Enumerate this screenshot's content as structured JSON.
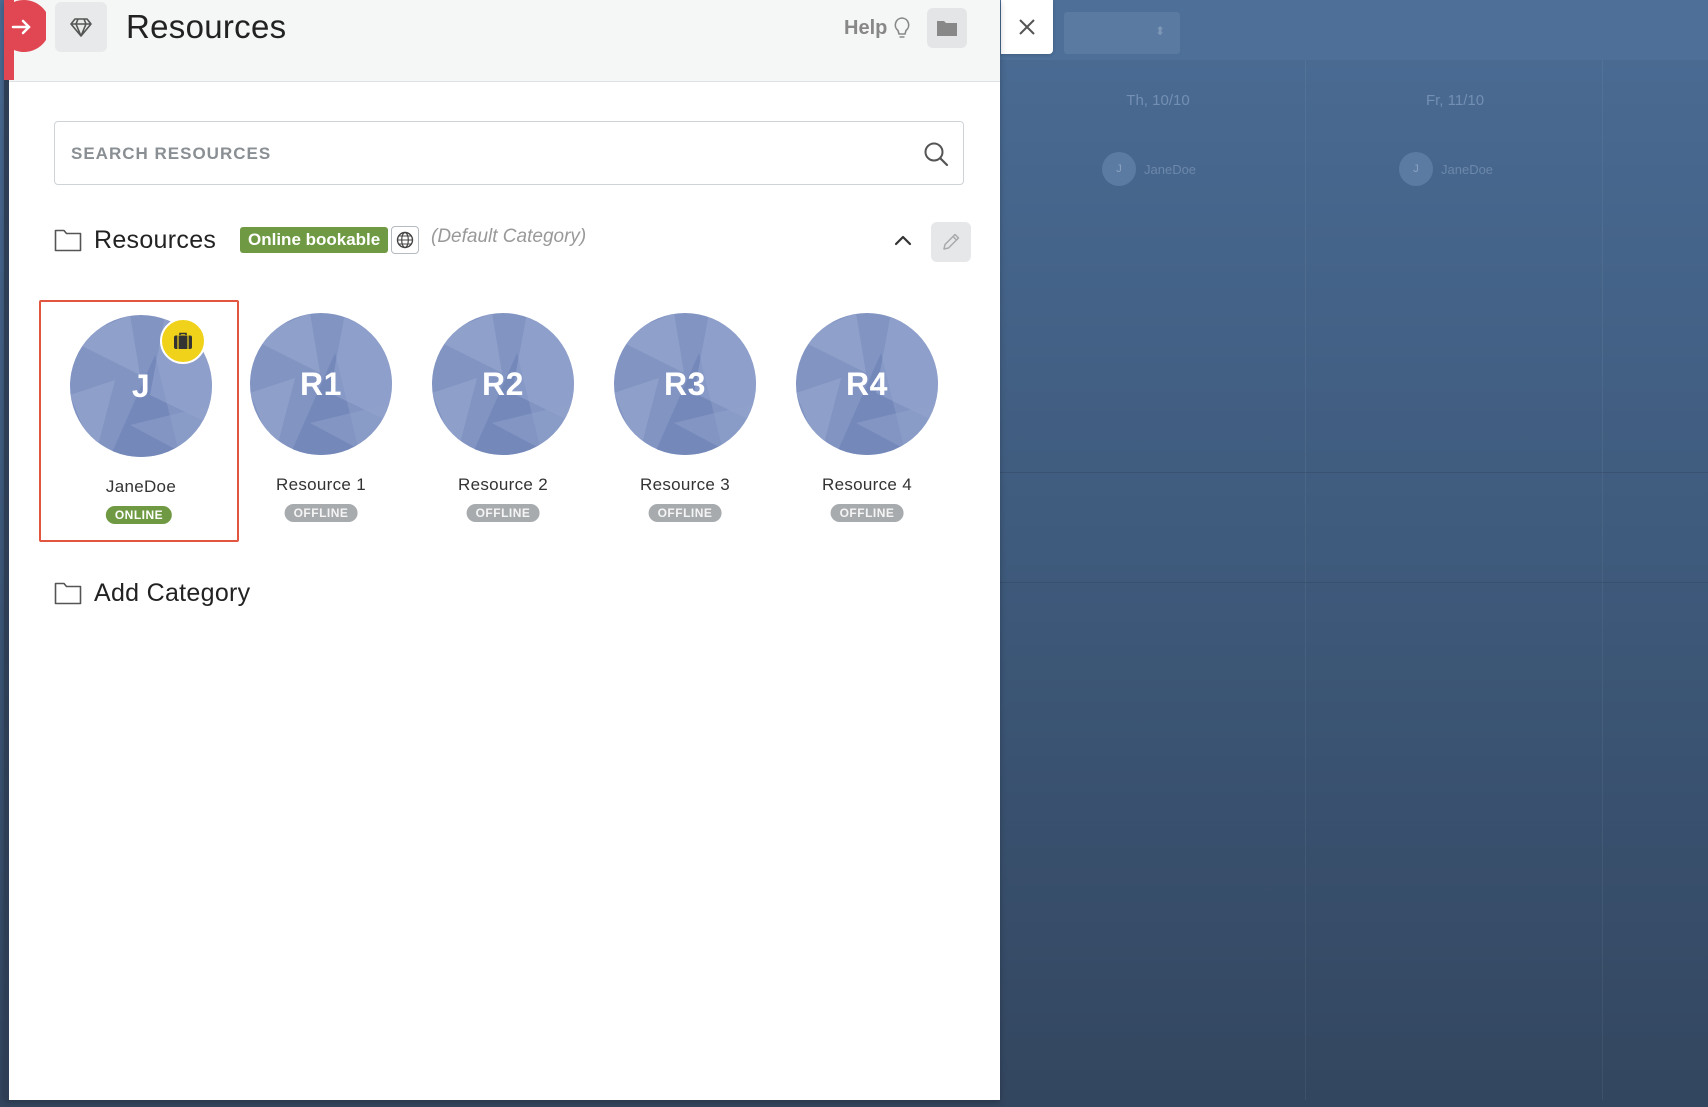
{
  "header": {
    "title": "Resources",
    "help_label": "Help"
  },
  "search": {
    "placeholder": "SEARCH RESOURCES",
    "value": ""
  },
  "category": {
    "name": "Resources",
    "badge": "Online bookable",
    "default_label": "(Default Category)"
  },
  "resources": [
    {
      "initials": "J",
      "name": "JaneDoe",
      "status": "ONLINE"
    },
    {
      "initials": "R1",
      "name": "Resource 1",
      "status": "OFFLINE"
    },
    {
      "initials": "R2",
      "name": "Resource 2",
      "status": "OFFLINE"
    },
    {
      "initials": "R3",
      "name": "Resource 3",
      "status": "OFFLINE"
    },
    {
      "initials": "R4",
      "name": "Resource 4",
      "status": "OFFLINE"
    }
  ],
  "add_category": {
    "label": "Add Category"
  },
  "background": {
    "days": [
      "Th, 10/10",
      "Fr, 11/10"
    ],
    "chip_label": "JaneDoe",
    "chip_initial": "J"
  },
  "colors": {
    "accent_red": "#e2553e",
    "online_green": "#6f9a43",
    "offline_gray": "#a7abae",
    "badge_yellow": "#f0d21a",
    "avatar_blue": "#8194c2"
  },
  "icons": {
    "back": "arrow-right-icon",
    "header": "diamond-icon",
    "help": "lightbulb-icon",
    "folder": "folder-icon",
    "search": "search-icon",
    "globe": "globe-icon",
    "collapse": "chevron-up-icon",
    "edit": "pencil-icon",
    "briefcase": "briefcase-icon",
    "close": "close-icon"
  }
}
